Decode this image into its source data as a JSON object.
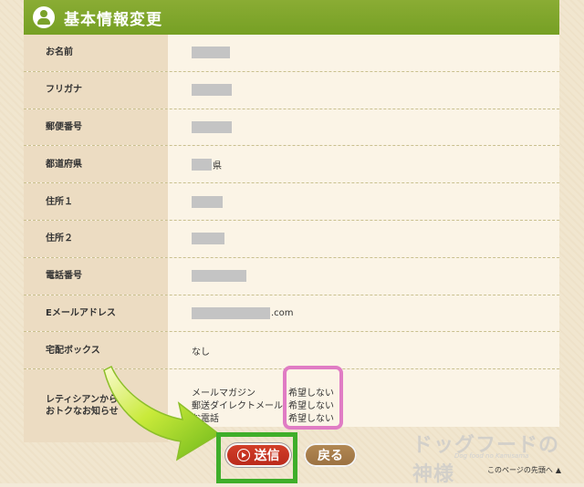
{
  "header": {
    "title": "基本情報変更",
    "icon": "user-icon"
  },
  "rows": [
    {
      "label": "お名前",
      "blur_width": 42
    },
    {
      "label": "フリガナ",
      "blur_width": 44
    },
    {
      "label": "郵便番号",
      "blur_width": 44
    },
    {
      "label": "都道府県",
      "blur_width": 22,
      "suffix": "県"
    },
    {
      "label": "住所１",
      "blur_width": 34
    },
    {
      "label": "住所２",
      "blur_width": 36
    },
    {
      "label": "電話番号",
      "blur_width": 60
    },
    {
      "label": "Eメールアドレス",
      "blur_width": 86,
      "suffix": ".com"
    },
    {
      "label": "宅配ボックス",
      "value": "なし"
    }
  ],
  "notifications": {
    "label": "レティシアンからのおトクなお知らせ",
    "label_visible": "レティシアンから\nおトクなお知らせ",
    "items": [
      {
        "name": "メールマガジン",
        "value": "希望しない"
      },
      {
        "name": "郵送ダイレクトメール",
        "value": "希望しない"
      },
      {
        "name": "お電話",
        "value": "希望しない"
      }
    ]
  },
  "buttons": {
    "send": "送信",
    "back": "戻る"
  },
  "watermark": {
    "text": "ドッグフードの神様",
    "sub": "Dog food no Kamisama"
  },
  "footer": {
    "page_top": "このページの先頭へ"
  },
  "colors": {
    "header_green": "#7aa22a",
    "send_red": "#c4321f",
    "back_brown": "#a67c48",
    "highlight_pink": "#e07cc4",
    "highlight_green": "#3fae2a"
  }
}
